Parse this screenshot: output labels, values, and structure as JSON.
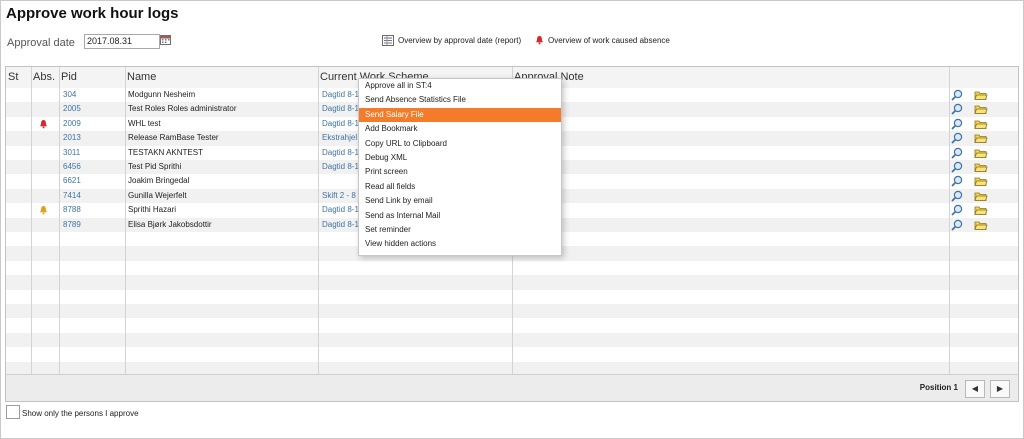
{
  "page": {
    "title": "Approve work hour logs",
    "approval_date_label": "Approval date",
    "approval_date_value": "2017.08.31",
    "overview_by_date_link": "Overview by approval date (report)",
    "overview_work_absence_link": "Overview of work caused absence"
  },
  "table": {
    "columns": [
      "St",
      "Abs.",
      "Pid",
      "Name",
      "Current Work Scheme",
      "Approval Note"
    ],
    "rows": [
      {
        "pid": "304",
        "name": "Modgunn Nesheim",
        "scheme": "Dagtid 8-1",
        "abs": ""
      },
      {
        "pid": "2005",
        "name": "Test Roles Roles administrator",
        "scheme": "Dagtid 8-1",
        "abs": ""
      },
      {
        "pid": "2009",
        "name": "WHL test",
        "scheme": "Dagtid 8-1",
        "abs": "red-bell-icon"
      },
      {
        "pid": "2013",
        "name": "Release RamBase Tester",
        "scheme": "Ekstrahjel",
        "abs": ""
      },
      {
        "pid": "3011",
        "name": "TESTAKN AKNTEST",
        "scheme": "Dagtid 8-1",
        "abs": ""
      },
      {
        "pid": "6456",
        "name": "Test Pid Sprithi",
        "scheme": "Dagtid 8-1",
        "abs": ""
      },
      {
        "pid": "6621",
        "name": "Joakim Bringedal",
        "scheme": "",
        "abs": ""
      },
      {
        "pid": "7414",
        "name": "Gunilla Wejerfelt",
        "scheme": "Skift 2 - 8",
        "abs": ""
      },
      {
        "pid": "8788",
        "name": "Sprithi Hazari",
        "scheme": "Dagtid 8-1",
        "abs": "yellow-bell-icon"
      },
      {
        "pid": "8789",
        "name": "Elisa Bjørk Jakobsdottir",
        "scheme": "Dagtid 8-1",
        "abs": ""
      }
    ]
  },
  "context_menu": {
    "items": [
      "Approve all in ST:4",
      "Send Absence Statistics File",
      "Send Salary File",
      "Add Bookmark",
      "Copy URL to Clipboard",
      "Debug XML",
      "Print screen",
      "Read all fields",
      "Send Link by email",
      "Send as Internal Mail",
      "Set reminder",
      "View hidden actions"
    ],
    "selected": "Send Salary File"
  },
  "footer": {
    "position_label": "Position 1",
    "prev_label": "◀",
    "next_label": "▶"
  },
  "show_only_label": "Show only the persons I approve",
  "colors": {
    "accent": "#f47b2a",
    "link": "#3f73a6"
  }
}
